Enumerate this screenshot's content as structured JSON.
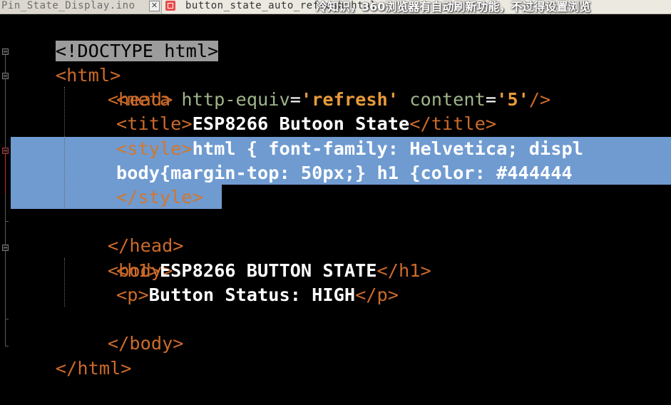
{
  "tabs": [
    {
      "label": "Pin_State_Display.ino"
    },
    {
      "label": "button_state_auto_refresh.html"
    }
  ],
  "overlay_caption": "冷知识，360浏览器有自动刷新功能，不过得设置浏览",
  "code": {
    "doctype": "<!DOCTYPE html>",
    "html_open": "<html>",
    "head_open": "<head>",
    "meta_open": "<meta",
    "meta_attr1": "http-equiv",
    "meta_eq1": "=",
    "meta_val1": "'refresh'",
    "meta_attr2": "content",
    "meta_eq2": "=",
    "meta_val2": "'5'",
    "meta_close": "/>",
    "title_open": "<title>",
    "title_text": "ESP8266 Butoon State",
    "title_close": "</title>",
    "style_open": "<style>",
    "style_text1": "html { font-family: Helvetica; displ",
    "style_text2": "body{margin-top: 50px;} h1 {color: #444444",
    "style_close": "</style>",
    "head_close": "</head>",
    "body_open": "<body>",
    "h1_open": "<h1>",
    "h1_text": "ESP8266 BUTTON STATE",
    "h1_close": "</h1>",
    "p_open": "<p>",
    "p_text": "Button Status: HIGH",
    "p_close": "</p>",
    "body_close": "</body>",
    "html_close": "</html>"
  },
  "colors": {
    "background": "#000000",
    "tag": "#cc6b2a",
    "attribute": "#9fb48a",
    "string_value": "#e89a3c",
    "text": "#ffffff",
    "selection": "#6f9bd1"
  }
}
